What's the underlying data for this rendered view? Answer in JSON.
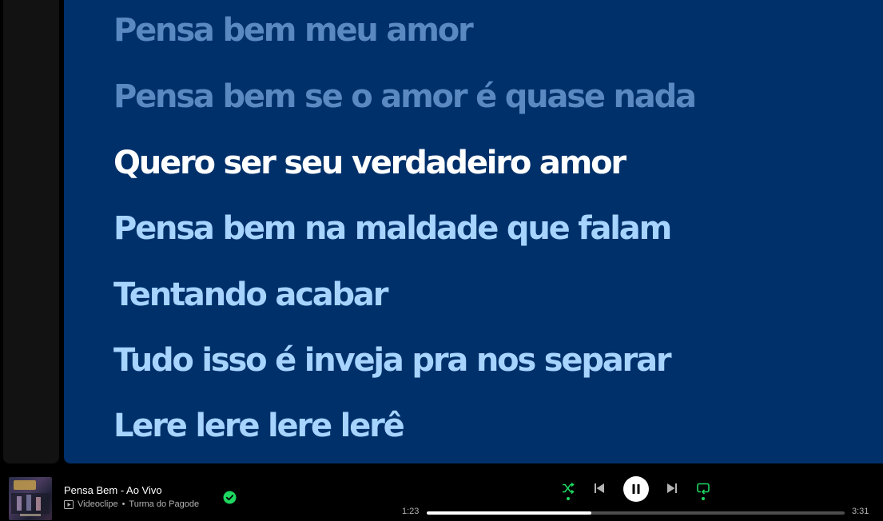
{
  "lyrics": {
    "lines": [
      {
        "text": "Pensa bem meu amor",
        "state": "past"
      },
      {
        "text": "Pensa bem se o amor é quase nada",
        "state": "past"
      },
      {
        "text": "Quero ser seu verdadeiro amor",
        "state": "active"
      },
      {
        "text": "Pensa bem na maldade que falam",
        "state": "future"
      },
      {
        "text": "Tentando acabar",
        "state": "future"
      },
      {
        "text": "Tudo isso é inveja pra nos separar",
        "state": "future"
      },
      {
        "text": "Lere lere lere lerê",
        "state": "future"
      }
    ],
    "colors": {
      "background": "#00306a",
      "past": "#5a88c0",
      "active": "#ffffff",
      "future": "#a6d4ff"
    }
  },
  "player": {
    "track_title": "Pensa Bem - Ao Vivo",
    "media_type": "Videoclipe",
    "separator": "•",
    "artist": "Turma do Pagode",
    "saved": true,
    "time_elapsed": "1:23",
    "time_total": "3:31",
    "progress_fraction": 0.394,
    "shuffle_active": true,
    "repeat_active": true,
    "is_playing": true,
    "icons": {
      "shuffle": "shuffle-icon",
      "previous": "skip-back-icon",
      "pause": "pause-icon",
      "next": "skip-forward-icon",
      "repeat": "repeat-icon",
      "saved": "check-circle-icon",
      "video": "video-icon"
    },
    "accent_color": "#1ed760"
  }
}
